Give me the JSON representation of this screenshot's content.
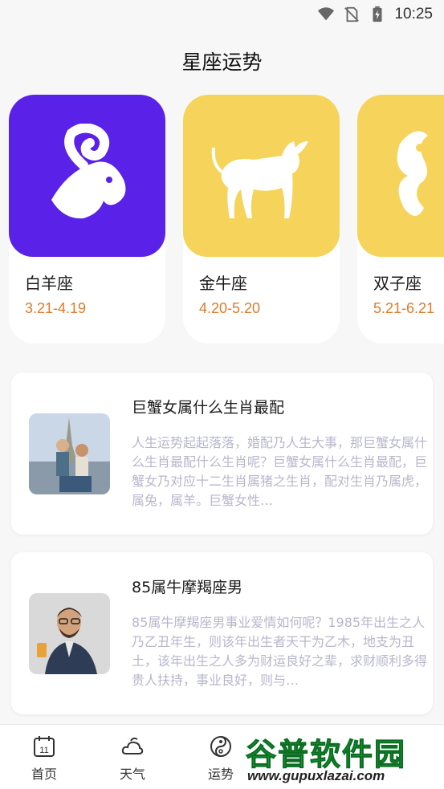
{
  "status_bar": {
    "time": "10:25",
    "icons": [
      "wifi-icon",
      "no-sim-icon",
      "battery-charging-icon"
    ]
  },
  "page": {
    "title": "星座运势"
  },
  "zodiac_cards": [
    {
      "name": "白羊座",
      "dates": "3.21-4.19",
      "color": "#5a22e8",
      "icon": "ram-icon"
    },
    {
      "name": "金牛座",
      "dates": "4.20-5.20",
      "color": "#f6d45c",
      "icon": "bull-icon"
    },
    {
      "name": "双子座",
      "dates": "5.21-6.21",
      "color": "#f6d45c",
      "icon": "twins-icon"
    }
  ],
  "articles": [
    {
      "title": "巨蟹女属什么生肖最配",
      "desc": "人生运势起起落落，婚配乃人生大事，那巨蟹女属什么生肖最配什么生肖呢？巨蟹女属什么生肖最配，巨蟹女乃对应十二生肖属猪之生肖，配对生肖乃属虎，属兔，属羊。巨蟹女性…"
    },
    {
      "title": "85属牛摩羯座男",
      "desc": "85属牛摩羯座男事业爱情如何呢？1985年出生之人乃乙丑年生，则该年出生者天干为乙木，地支为丑土，该年出生之人多为财运良好之辈，求财顺利多得贵人扶持，事业良好，则与…"
    }
  ],
  "nav": [
    {
      "label": "首页",
      "icon": "calendar-icon"
    },
    {
      "label": "天气",
      "icon": "cloud-sun-icon"
    },
    {
      "label": "运势",
      "icon": "yin-yang-icon"
    }
  ],
  "watermark": {
    "text": "谷普软件园",
    "url": "www.gupuxlazai.com"
  },
  "colors": {
    "accent_orange": "#e07a2a",
    "purple": "#5a22e8",
    "yellow": "#f6d45c"
  }
}
